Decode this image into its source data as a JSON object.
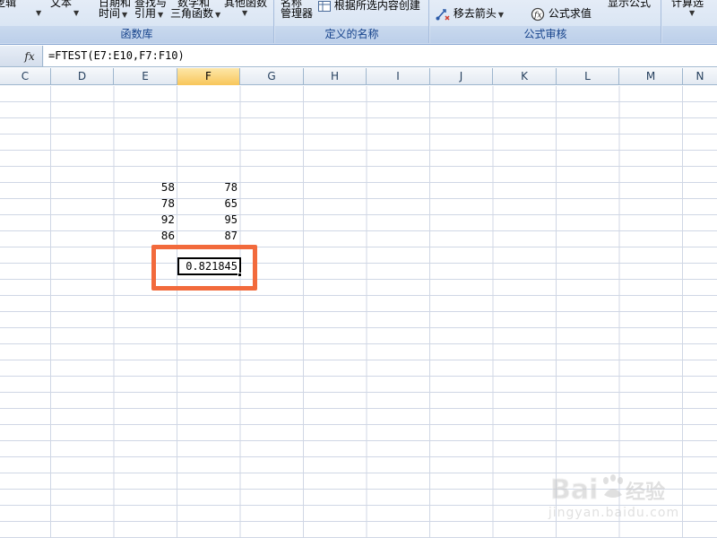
{
  "ribbon": {
    "groups": {
      "function_library": {
        "label": "函数库"
      },
      "defined_names": {
        "label": "定义的名称"
      },
      "formula_auditing": {
        "label": "公式审核"
      }
    },
    "cut_labels": {
      "c1": "逻辑",
      "c2": "文本",
      "c3": "日期和",
      "c4": "查找与",
      "c5": "数学和",
      "c6": "其他函数",
      "c7": "名称",
      "c8": "显示公式",
      "c9": "计算选"
    },
    "buttons": {
      "datetime": "时间",
      "lookup": "引用",
      "math": "三角函数",
      "name_manager": "管理器",
      "create_from_selection": "根据所选内容创建",
      "remove_arrows": "移去箭头",
      "evaluate_formula": "公式求值"
    }
  },
  "formula_bar": {
    "fx_label": "fx",
    "formula": "=FTEST(E7:E10,F7:F10)"
  },
  "columns": [
    "C",
    "D",
    "E",
    "F",
    "G",
    "H",
    "I",
    "J",
    "K",
    "L",
    "M",
    "N"
  ],
  "selected_column": "F",
  "cells": {
    "e7": "58",
    "f7": "78",
    "e8": "78",
    "f8": "65",
    "e9": "92",
    "f9": "95",
    "e10": "86",
    "f10": "87",
    "f11": "0.821845"
  },
  "watermark": {
    "brand": "Baidu经验",
    "url": "jingyan.baidu.com"
  },
  "colors": {
    "highlight": "#f26a3c",
    "ribbon_label": "#15428b",
    "selected_header": "#f8c65a"
  }
}
